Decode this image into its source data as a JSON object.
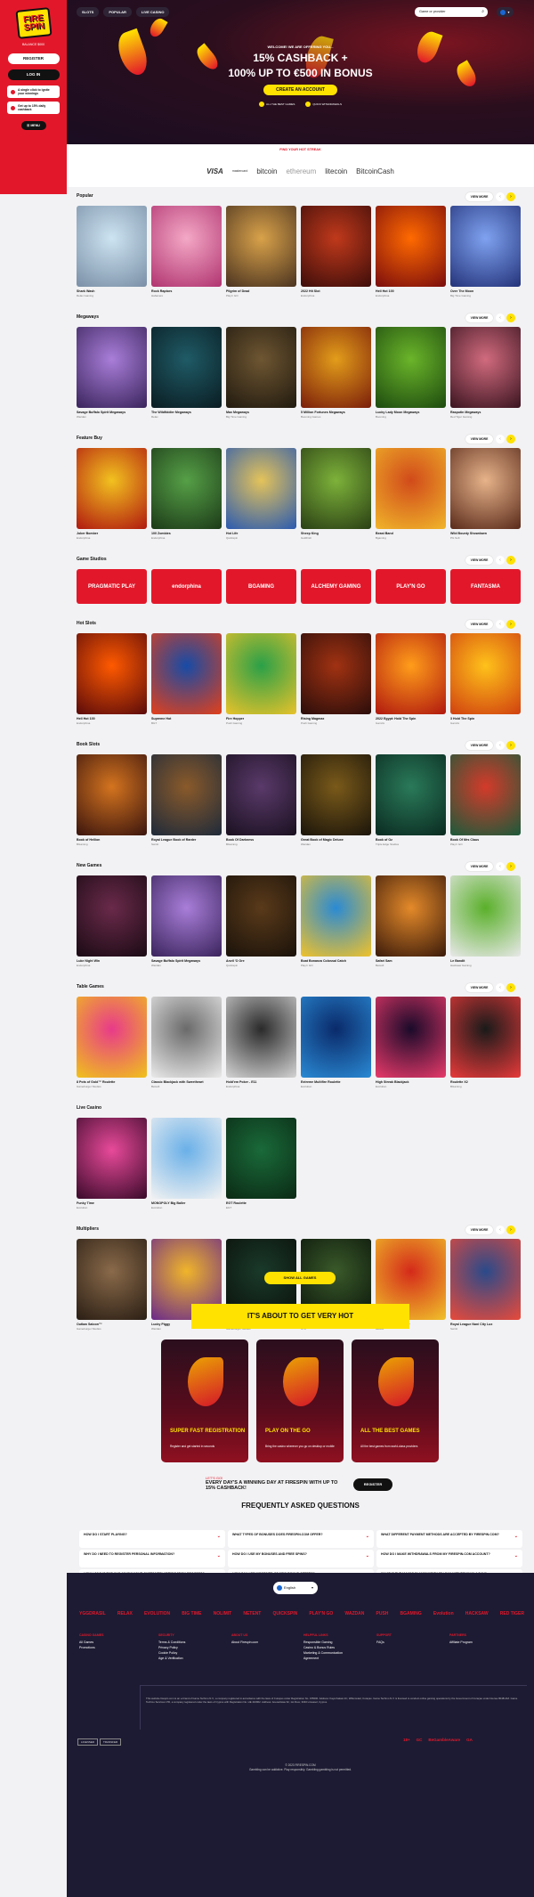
{
  "sidebar": {
    "logo": "FIRE SPIN",
    "subtitle": "BALANCE $000",
    "register_label": "REGISTER",
    "login_label": "LOG IN",
    "promos": [
      "A single click to ignite your winnings",
      "Get up to 15% daily cashback"
    ],
    "menu_label": "MENU"
  },
  "nav": {
    "tabs": [
      "SLOTS",
      "POPULAR",
      "LIVE CASINO"
    ]
  },
  "search": {
    "placeholder": "Game or provider"
  },
  "hero": {
    "welcome": "WELCOME! WE ARE OFFERING YOU...",
    "line1": "15% CASHBACK +",
    "line2": "100% UP TO €500 IN BONUS",
    "cta": "CREATE AN ACCOUNT",
    "features": [
      "ALL THE BEST GAMES",
      "QUICK WITHDRAWALS"
    ]
  },
  "streak_label": "FIND YOUR HOT STREAK",
  "payments": [
    "VISA",
    "mastercard",
    "bitcoin",
    "ethereum",
    "litecoin",
    "BitcoinCash"
  ],
  "view_more": "VIEW MORE",
  "sections": [
    {
      "title": "Popular",
      "games": [
        {
          "name": "Shark Wash",
          "provider": "Relax Gaming",
          "c1": "#cde4f2",
          "c2": "#7a8fa6"
        },
        {
          "name": "Rock Raptors",
          "provider": "Habanero",
          "c1": "#f4a8c6",
          "c2": "#b03470"
        },
        {
          "name": "Pilgrim of Dead",
          "provider": "Play'n GO",
          "c1": "#d9a24a",
          "c2": "#4a3320"
        },
        {
          "name": "2022 Hit Slot",
          "provider": "Endorphina",
          "c1": "#c0391b",
          "c2": "#3d0d0a"
        },
        {
          "name": "Hell Hot 100",
          "provider": "Endorphina",
          "c1": "#ff6a00",
          "c2": "#7a0c0c"
        },
        {
          "name": "Over The Moon",
          "provider": "Big Time Gaming",
          "c1": "#7fa2f0",
          "c2": "#24337a"
        }
      ]
    },
    {
      "title": "Megaways",
      "games": [
        {
          "name": "Savage Buffalo Spirit Megaways",
          "provider": "Wazdan",
          "c1": "#a97ed9",
          "c2": "#3a245c"
        },
        {
          "name": "The Wildfiddler Megaways",
          "provider": "Relax",
          "c1": "#1f5b66",
          "c2": "#0a1c22"
        },
        {
          "name": "Max Megaways",
          "provider": "Big Time Gaming",
          "c1": "#6e5632",
          "c2": "#211a0f"
        },
        {
          "name": "5 Million Fortunes Megaways",
          "provider": "Booming Games",
          "c1": "#e39d1a",
          "c2": "#7a1d0a"
        },
        {
          "name": "Lucky Lady Moon Megaways",
          "provider": "Booming",
          "c1": "#6bb52a",
          "c2": "#1d4a0f"
        },
        {
          "name": "Rasputin Megaways",
          "provider": "Red Tiger Gaming",
          "c1": "#d16b7e",
          "c2": "#3a1420"
        }
      ]
    },
    {
      "title": "Feature Buy",
      "games": [
        {
          "name": "Joker Bomber",
          "provider": "Endorphina",
          "c1": "#f2c21f",
          "c2": "#b0180f"
        },
        {
          "name": "100 Zombies",
          "provider": "Endorphina",
          "c1": "#56a047",
          "c2": "#1c3a18"
        },
        {
          "name": "Hot Life",
          "provider": "Quickspin",
          "c1": "#e4c35a",
          "c2": "#2a5ab0"
        },
        {
          "name": "Sheep King",
          "provider": "GoldFish",
          "c1": "#7db23a",
          "c2": "#2a3f14"
        },
        {
          "name": "Beast Band",
          "provider": "Bgaming",
          "c1": "#d14a1a",
          "c2": "#f0b52a"
        },
        {
          "name": "Wild Bounty Showdown",
          "provider": "PG Soft",
          "c1": "#e6b38a",
          "c2": "#5a2a1a"
        }
      ]
    },
    {
      "title": "Game Studios",
      "studios": [
        "PRAGMATIC PLAY",
        "endorphina",
        "BGAMING",
        "ALCHEMY GAMING",
        "PLAY'N GO",
        "FANTASMA"
      ]
    },
    {
      "title": "Hot Slots",
      "games": [
        {
          "name": "Hell Hot 100",
          "provider": "Endorphina",
          "c1": "#ff5a00",
          "c2": "#5a0a0a"
        },
        {
          "name": "Supreme Hot",
          "provider": "BGT",
          "c1": "#174ba6",
          "c2": "#e2401a"
        },
        {
          "name": "Fire Hopper",
          "provider": "Push Gaming",
          "c1": "#2aa048",
          "c2": "#e8c22a"
        },
        {
          "name": "Rising Magmax",
          "provider": "Push Gaming",
          "c1": "#a13212",
          "c2": "#2a0d0a"
        },
        {
          "name": "2022 Egypt: Hold The Spin",
          "provider": "Gamzix",
          "c1": "#ff9d1a",
          "c2": "#b0180f"
        },
        {
          "name": "3 Hold The Spin",
          "provider": "Gamzix",
          "c1": "#ffc21a",
          "c2": "#d0400f"
        }
      ]
    },
    {
      "title": "Book Slots",
      "games": [
        {
          "name": "Book of Hellion",
          "provider": "BGaming",
          "c1": "#d4741f",
          "c2": "#3a140d"
        },
        {
          "name": "Royal League Book of Rarder",
          "provider": "Swintt",
          "c1": "#8a5a2a",
          "c2": "#1e2a3a"
        },
        {
          "name": "Book Of Darkness",
          "provider": "BGaming",
          "c1": "#5a3a6a",
          "c2": "#1a1020"
        },
        {
          "name": "Great Book of Magic Deluxe",
          "provider": "Wazdan",
          "c1": "#7a5a1a",
          "c2": "#1a140a"
        },
        {
          "name": "Book of Oz",
          "provider": "Triple Edge Studios",
          "c1": "#2a7a5a",
          "c2": "#0a2a20"
        },
        {
          "name": "Book Of Mrs Claus",
          "provider": "Play'n GO",
          "c1": "#d43a2a",
          "c2": "#1a5a3a"
        }
      ]
    },
    {
      "title": "New Games",
      "games": [
        {
          "name": "Luke Night Win",
          "provider": "Endorphina",
          "c1": "#6a2a4a",
          "c2": "#1a0a14"
        },
        {
          "name": "Savage Buffalo Spirit Megaways",
          "provider": "Wazdan",
          "c1": "#a97ed9",
          "c2": "#3a245c"
        },
        {
          "name": "Anvil 'O Ore",
          "provider": "Quickspin",
          "c1": "#5a3a1a",
          "c2": "#1a120a"
        },
        {
          "name": "Boat Bonanza Colossal Catch",
          "provider": "Play'n GO",
          "c1": "#2a8ad4",
          "c2": "#f0c22a"
        },
        {
          "name": "Safari Sam",
          "provider": "Betsoft",
          "c1": "#e48a2a",
          "c2": "#3a1a0a"
        },
        {
          "name": "Le Bandit",
          "provider": "Hacksaw Gaming",
          "c1": "#5ab02a",
          "c2": "#e8e8e8"
        }
      ]
    },
    {
      "title": "Table Games",
      "games": [
        {
          "name": "8 Pots of Gold™ Roulette",
          "provider": "Gameburger Studios",
          "c1": "#e83a8a",
          "c2": "#f0c21a"
        },
        {
          "name": "Classic Blackjack with Sweetheart",
          "provider": "Betsoft",
          "c1": "#6a6a6a",
          "c2": "#eaeaea"
        },
        {
          "name": "Hold'em Poker - E11",
          "provider": "Endorphina",
          "c1": "#2a2a2a",
          "c2": "#d4d4d4"
        },
        {
          "name": "Extreme Multifire Roulette",
          "provider": "Evolution",
          "c1": "#0a2a6a",
          "c2": "#2a8ad4"
        },
        {
          "name": "High Streak Blackjack",
          "provider": "Evolution",
          "c1": "#1a0a2a",
          "c2": "#e83a6a"
        },
        {
          "name": "Roulette X2",
          "provider": "BGaming",
          "c1": "#1a1a1a",
          "c2": "#e83a3a"
        }
      ]
    },
    {
      "title": "Live Casino",
      "games": [
        {
          "name": "Funky Time",
          "provider": "Evolution",
          "c1": "#e84a9a",
          "c2": "#3a0a2a"
        },
        {
          "name": "MONOPOLY Big Baller",
          "provider": "Evolution",
          "c1": "#6ab0e8",
          "c2": "#f2f2f2"
        },
        {
          "name": "EGT Roulette",
          "provider": "EGT",
          "c1": "#1a6a3a",
          "c2": "#0a2a14"
        }
      ]
    },
    {
      "title": "Multipliers",
      "games": [
        {
          "name": "Outlaw Saloon™",
          "provider": "Gameburger Studios",
          "c1": "#8a6a4a",
          "c2": "#2a1e14"
        },
        {
          "name": "Lucky Piggy",
          "provider": "Wazdan",
          "c1": "#f0b52a",
          "c2": "#6a2a8a"
        },
        {
          "name": "777 Strike",
          "provider": "Gameburger Studios",
          "c1": "#1a3a2a",
          "c2": "#0a0f0a"
        },
        {
          "name": "Silverback Multiplier Mountain",
          "provider": "NYX",
          "c1": "#3a5a2a",
          "c2": "#0a140a"
        },
        {
          "name": "Mega Money Multiplier",
          "provider": "Betsoft",
          "c1": "#d42a1a",
          "c2": "#f0c22a"
        },
        {
          "name": "Royal League Nani City Lux",
          "provider": "Swintt",
          "c1": "#2a4a8a",
          "c2": "#e84a3a"
        }
      ]
    }
  ],
  "show_all": "SHOW ALL GAMES",
  "hot": {
    "banner": "IT'S ABOUT TO GET VERY HOT",
    "cards": [
      {
        "title": "SUPER FAST REGISTRATION",
        "desc": "Register and get started in seconds"
      },
      {
        "title": "PLAY ON THE GO",
        "desc": "Bring the casino wherever you go on desktop or mobile"
      },
      {
        "title": "ALL THE BEST GAMES",
        "desc": "All the best games from world-class providers"
      }
    ],
    "everyday_pre": "LET'S GO!",
    "everyday": "EVERY DAY'S A WINNING DAY AT FIRESPIN WITH UP TO 15% CASHBACK!",
    "register": "REGISTER"
  },
  "faq": {
    "title": "FREQUENTLY ASKED QUESTIONS",
    "items": [
      "HOW DO I START PLAYING?",
      "WHAT TYPES OF BONUSES DOES FIRESPIN.COM OFFER?",
      "WHAT DIFFERENT PAYMENT METHODS ARE ACCEPTED BY FIRESPIN.COM?",
      "WHY DO I NEED TO REGISTER PERSONAL INFORMATION?",
      "HOW DO I USE MY BONUSES AND FREE SPINS?",
      "HOW DO I MAKE WITHDRAWALS FROM MY FIRESPIN.COM ACCOUNT?",
      "HOW LONG IS THE KYC (KNOW YOUR CUSTOMER) VERIFICATION PROCESS?",
      "HOW CAN I BE INFORMED OF NEW BONUS OFFERS?",
      "WHAT IS THE MAXIMUM AMOUNT THAT I CAN WITHDRAW IN A DAY?"
    ]
  },
  "footer": {
    "language": "English",
    "providers": [
      "YGGDRASIL",
      "RELAX",
      "EVOLUTION",
      "BIG TIME",
      "NOLIMIT",
      "NETENT",
      "QUICKSPIN",
      "PLAY'N GO",
      "WAZDAN",
      "PUSH",
      "BGAMING",
      "Evolution",
      "HACKSAW",
      "RED TIGER"
    ],
    "columns": [
      {
        "head": "CASINO GAMES",
        "links": [
          "All Games",
          "Promotions"
        ]
      },
      {
        "head": "SECURITY",
        "links": [
          "Terms & Conditions",
          "Privacy Policy",
          "Cookie Policy",
          "Age & Verification"
        ]
      },
      {
        "head": "ABOUT US",
        "links": [
          "About Firespin.com"
        ]
      },
      {
        "head": "HELPFUL LINKS",
        "links": [
          "Responsible Gaming",
          "Casino & Bonus Rules",
          "Marketing & Communication",
          "Agreement"
        ]
      },
      {
        "head": "SUPPORT",
        "links": [
          "FAQs"
        ]
      },
      {
        "head": "PARTNERS",
        "links": [
          "Affiliate Program"
        ]
      }
    ],
    "legal": "This website firespin.com is an e-brand of Game Techmo N.V., a company registered in accordance with the laws of Curaçao under Registration No. 155000. Address: Kaya Kakaw 2C, Willemstad, Curaçao. Game Techmo N.V. is licensed to conduct online gaming operations by the Government of Curaçao under license 8048/JAZ. Game Techmo Services LTD, a company registered under the laws of Cyprus with Registration No. HE 410962. Address: Anexartisias 62, 1st Floor, 3040 Limassol, Cyprus.",
    "badges": [
      "LICENSED",
      "TRANSFER"
    ],
    "resp": [
      "18+",
      "GC",
      "BeGambleAware",
      "GA"
    ],
    "copyright": "© 2023 FIRESPIN.COM",
    "copyright2": "Gambling can be addictive. Play responsibly. Gambling gambling is not permitted."
  }
}
